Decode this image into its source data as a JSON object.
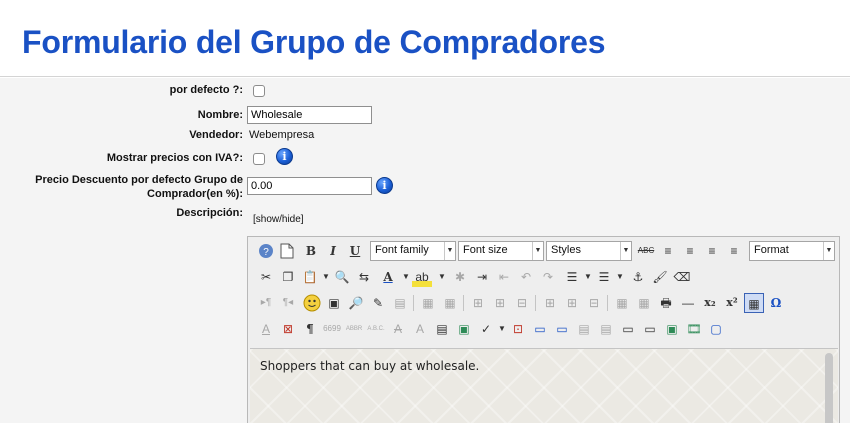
{
  "page": {
    "title": "Formulario del Grupo de Compradores"
  },
  "form": {
    "default_label": "por defecto ?:",
    "name_label": "Nombre:",
    "name_value": "Wholesale",
    "vendor_label": "Vendedor:",
    "vendor_value": "Webempresa",
    "show_prices_label": "Mostrar precios con IVA?:",
    "discount_label": "Precio Descuento por defecto Grupo de Comprador(en %):",
    "discount_value": "0.00",
    "description_label": "Descripción:",
    "show_hide_link": "[show/hide]"
  },
  "editor": {
    "font_family": "Font family",
    "font_size": "Font size",
    "styles": "Styles",
    "format": "Format",
    "content": "Shoppers that can buy at wholesale."
  },
  "colors": {
    "title": "#1a51c4",
    "info_icon": "#1b5fd6"
  }
}
